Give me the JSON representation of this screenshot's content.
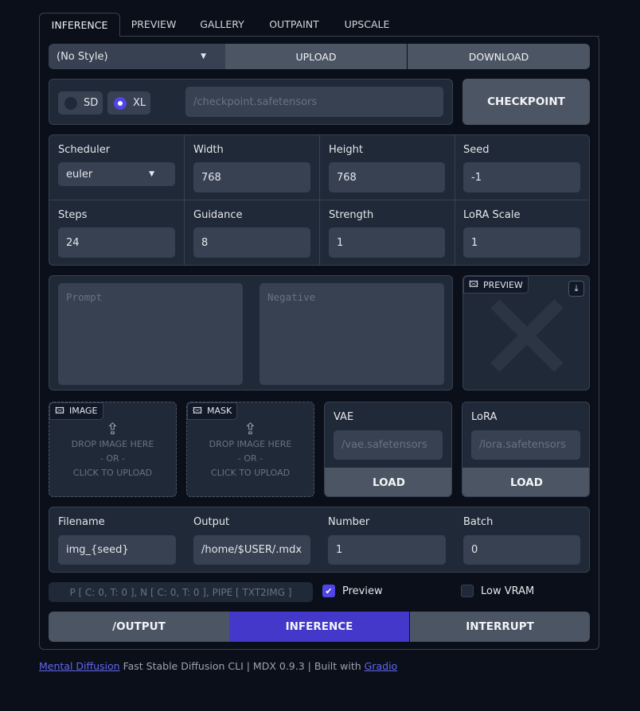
{
  "tabs": [
    "INFERENCE",
    "PREVIEW",
    "GALLERY",
    "OUTPAINT",
    "UPSCALE"
  ],
  "style": {
    "selected": "(No Style)",
    "upload": "UPLOAD",
    "download": "DOWNLOAD"
  },
  "model": {
    "sd": "SD",
    "xl": "XL",
    "selected": "XL",
    "checkpoint_placeholder": "/checkpoint.safetensors",
    "checkpoint_button": "CHECKPOINT"
  },
  "params": [
    {
      "label": "Scheduler",
      "value": "euler"
    },
    {
      "label": "Width",
      "value": "768"
    },
    {
      "label": "Height",
      "value": "768"
    },
    {
      "label": "Seed",
      "value": "-1"
    },
    {
      "label": "Steps",
      "value": "24"
    },
    {
      "label": "Guidance",
      "value": "8"
    },
    {
      "label": "Strength",
      "value": "1"
    },
    {
      "label": "LoRA Scale",
      "value": "1"
    }
  ],
  "prompt": {
    "prompt_placeholder": "Prompt",
    "negative_placeholder": "Negative",
    "preview_label": "PREVIEW"
  },
  "uploads": {
    "image": "IMAGE",
    "mask": "MASK",
    "drop": "DROP IMAGE HERE",
    "or": "- OR -",
    "click": "CLICK TO UPLOAD"
  },
  "vae": {
    "label": "VAE",
    "placeholder": "/vae.safetensors",
    "button": "LOAD"
  },
  "lora": {
    "label": "LoRA",
    "placeholder": "/lora.safetensors",
    "button": "LOAD"
  },
  "output": [
    {
      "label": "Filename",
      "value": "img_{seed}"
    },
    {
      "label": "Output",
      "value": "/home/$USER/.mdx"
    },
    {
      "label": "Number",
      "value": "1"
    },
    {
      "label": "Batch",
      "value": "0"
    }
  ],
  "status": "P [ C: 0, T: 0 ], N [ C: 0, T: 0 ], PIPE [ TXT2IMG ]",
  "checkboxes": {
    "preview": "Preview",
    "preview_checked": true,
    "low_vram": "Low VRAM",
    "low_vram_checked": false
  },
  "actions": {
    "output": "/OUTPUT",
    "inference": "INFERENCE",
    "interrupt": "INTERRUPT"
  },
  "footer": {
    "link1": "Mental Diffusion",
    "text1": " Fast Stable Diffusion CLI | MDX 0.9.3 | Built with ",
    "link2": "Gradio"
  },
  "colors": {
    "primary": "#4338ca",
    "bg": "#0b0f19",
    "panel": "#1f2937"
  }
}
